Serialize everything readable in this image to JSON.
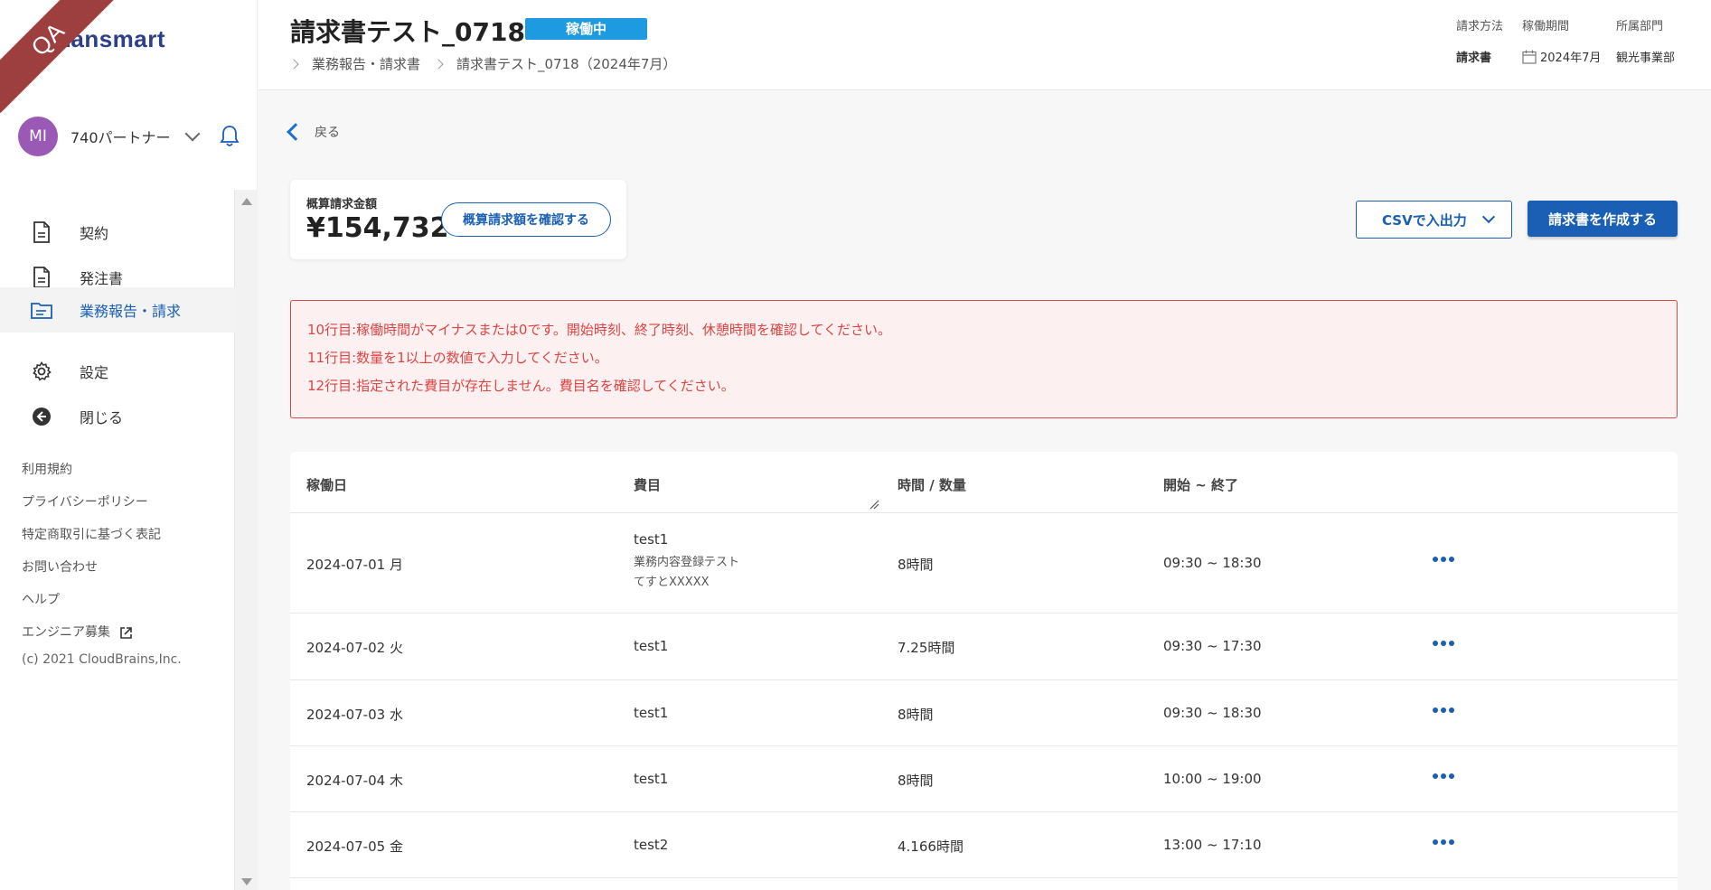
{
  "ribbon": "QA",
  "brand": {
    "name": "Lansmart"
  },
  "user": {
    "initials": "MI",
    "name": "740パートナー"
  },
  "nav": [
    {
      "label": "契約",
      "icon": "document-icon",
      "active": false
    },
    {
      "label": "発注書",
      "icon": "document-icon",
      "active": false
    },
    {
      "label": "業務報告・請求",
      "icon": "folder-icon",
      "active": true
    },
    {
      "label": "設定",
      "icon": "gear-icon",
      "active": false
    },
    {
      "label": "閉じる",
      "icon": "back-circle-icon",
      "active": false
    }
  ],
  "footer_links": [
    "利用規約",
    "プライバシーポリシー",
    "特定商取引に基づく表記",
    "お問い合わせ",
    "ヘルプ",
    "エンジニア募集"
  ],
  "copyright": "(c) 2021 CloudBrains,Inc.",
  "header": {
    "title": "請求書テスト_0718",
    "status": "稼働中",
    "breadcrumb": [
      "業務報告・請求書",
      "請求書テスト_0718（2024年7月）"
    ],
    "meta": {
      "method_label": "請求方法",
      "method_value": "請求書",
      "period_label": "稼働期間",
      "period_value": "2024年7月",
      "dept_label": "所属部門",
      "dept_value": "観光事業部"
    }
  },
  "back_label": "戻る",
  "amount": {
    "label": "概算請求金額",
    "value": "¥154,732",
    "confirm_button": "概算請求額を確認する"
  },
  "actions": {
    "csv_button": "CSVで入出力",
    "create_button": "請求書を作成する"
  },
  "errors": [
    "10行目:稼働時間がマイナスまたは0です。開始時刻、終了時刻、休憩時間を確認してください。",
    "11行目:数量を1以上の数値で入力してください。",
    "12行目:指定された費目が存在しません。費目名を確認してください。"
  ],
  "table": {
    "headers": {
      "date": "稼働日",
      "item": "費目",
      "qty": "時間 / 数量",
      "range": "開始 ~ 終了"
    },
    "rows": [
      {
        "date": "2024-07-01 月",
        "item": "test1",
        "desc1": "業務内容登録テスト",
        "desc2": "てすとXXXXX",
        "qty": "8時間",
        "range": "09:30 ~ 18:30"
      },
      {
        "date": "2024-07-02 火",
        "item": "test1",
        "desc1": "",
        "desc2": "",
        "qty": "7.25時間",
        "range": "09:30 ~ 17:30"
      },
      {
        "date": "2024-07-03 水",
        "item": "test1",
        "desc1": "",
        "desc2": "",
        "qty": "8時間",
        "range": "09:30 ~ 18:30"
      },
      {
        "date": "2024-07-04 木",
        "item": "test1",
        "desc1": "",
        "desc2": "",
        "qty": "8時間",
        "range": "10:00 ~ 19:00"
      },
      {
        "date": "2024-07-05 金",
        "item": "test2",
        "desc1": "",
        "desc2": "",
        "qty": "4.166時間",
        "range": "13:00 ~ 17:10"
      }
    ]
  },
  "colors": {
    "primary": "#1a5fb4",
    "badge": "#1e9be0",
    "error": "#d44444",
    "avatar": "#9b59b6"
  }
}
